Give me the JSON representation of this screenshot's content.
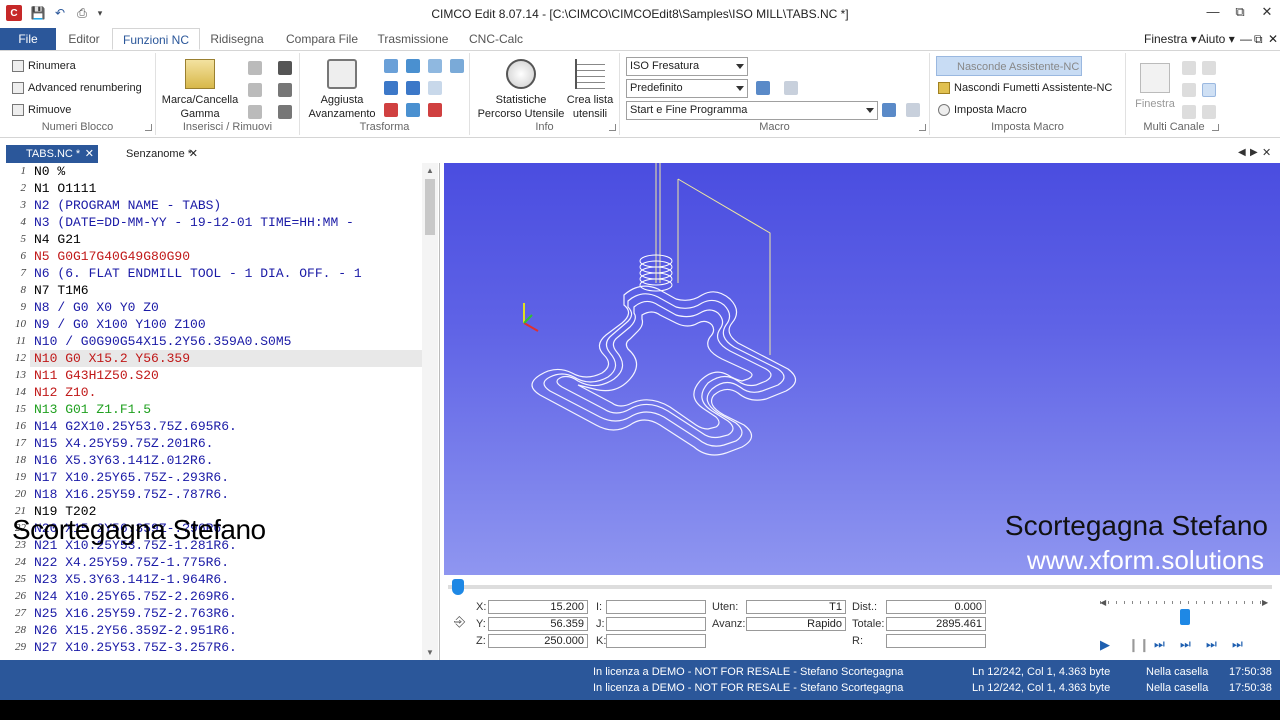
{
  "app": {
    "title": "CIMCO Edit 8.07.14 - [C:\\CIMCO\\CIMCOEdit8\\Samples\\ISO MILL\\TABS.NC *]"
  },
  "tabs": {
    "file": "File",
    "items": [
      "Editor",
      "Funzioni NC",
      "Ridisegna",
      "Compara File",
      "Trasmissione",
      "CNC-Calc"
    ],
    "active": "Funzioni NC",
    "right_menus": [
      "Finestra",
      "Aiuto"
    ]
  },
  "ribbon": {
    "numeri_blocco": {
      "label": "Numeri Blocco",
      "buttons": [
        "Rinumera",
        "Advanced renumbering",
        "Rimuove"
      ]
    },
    "inserisci": {
      "label": "Inserisci / Rimuovi",
      "big_button": "Marca/Cancella Gamma"
    },
    "trasforma": {
      "label": "Trasforma",
      "big_button": "Aggiusta Avanzamento"
    },
    "info": {
      "label": "Info",
      "buttons": [
        "Statistiche Percorso Utensile",
        "Crea lista utensili"
      ]
    },
    "macro": {
      "label": "Macro",
      "combo1": "ISO Fresatura",
      "combo2": "Predefinito",
      "combo3": "Start e Fine Programma"
    },
    "imposta_macro": {
      "label": "Imposta Macro",
      "buttons": [
        "Nasconde Assistente-NC",
        "Nascondi Fumetti Assistente-NC",
        "Imposta Macro"
      ]
    },
    "multi_canale": {
      "label": "Multi Canale",
      "button": "Finestra"
    }
  },
  "doc_tabs": [
    {
      "label": "TABS.NC *",
      "active": true
    },
    {
      "label": "Senzanome *",
      "active": false
    }
  ],
  "editor": {
    "lines": [
      {
        "n": "1",
        "text": "N0 %",
        "color": "#000000"
      },
      {
        "n": "2",
        "text": "N1 O1111",
        "color": "#000000"
      },
      {
        "n": "3",
        "text": "N2 (PROGRAM NAME - TABS)",
        "color": "#1a1aa6"
      },
      {
        "n": "4",
        "text": "N3 (DATE=DD-MM-YY - 19-12-01 TIME=HH:MM - ",
        "color": "#1a1aa6"
      },
      {
        "n": "5",
        "text": "N4 G21",
        "color": "#000000"
      },
      {
        "n": "6",
        "text": "N5 G0G17G40G49G80G90",
        "color": "#c01818"
      },
      {
        "n": "7",
        "text": "N6 (6. FLAT ENDMILL TOOL - 1 DIA. OFF. - 1",
        "color": "#1a1aa6"
      },
      {
        "n": "8",
        "text": "N7 T1M6",
        "color": "#000000"
      },
      {
        "n": "9",
        "text": "N8 / G0 X0 Y0 Z0",
        "color": "#1a1aa6"
      },
      {
        "n": "10",
        "text": "N9 / G0 X100 Y100 Z100",
        "color": "#1a1aa6"
      },
      {
        "n": "11",
        "text": "N10 / G0G90G54X15.2Y56.359A0.S0M5",
        "color": "#1a1aa6"
      },
      {
        "n": "12",
        "text": "N10 G0 X15.2 Y56.359",
        "color": "#c01818"
      },
      {
        "n": "13",
        "text": "N11 G43H1Z50.S20",
        "color": "#c01818"
      },
      {
        "n": "14",
        "text": "N12 Z10.",
        "color": "#c01818"
      },
      {
        "n": "15",
        "text": "N13 G01 Z1.F1.5",
        "color": "#1fa01f"
      },
      {
        "n": "16",
        "text": "N14 G2X10.25Y53.75Z.695R6.",
        "color": "#1a1aa6"
      },
      {
        "n": "17",
        "text": "N15 X4.25Y59.75Z.201R6.",
        "color": "#1a1aa6"
      },
      {
        "n": "18",
        "text": "N16 X5.3Y63.141Z.012R6.",
        "color": "#1a1aa6"
      },
      {
        "n": "19",
        "text": "N17 X10.25Y65.75Z-.293R6.",
        "color": "#1a1aa6"
      },
      {
        "n": "20",
        "text": "N18 X16.25Y59.75Z-.787R6.",
        "color": "#1a1aa6"
      },
      {
        "n": "21",
        "text": "N19 T202",
        "color": "#000000"
      },
      {
        "n": "22",
        "text": "N20 X15.2Y56.359Z-.?96R6.",
        "color": "#1a1aa6"
      },
      {
        "n": "23",
        "text": "N21 X10.25Y53.75Z-1.281R6.",
        "color": "#1a1aa6"
      },
      {
        "n": "24",
        "text": "N22 X4.25Y59.75Z-1.775R6.",
        "color": "#1a1aa6"
      },
      {
        "n": "25",
        "text": "N23 X5.3Y63.141Z-1.964R6.",
        "color": "#1a1aa6"
      },
      {
        "n": "26",
        "text": "N24 X10.25Y65.75Z-2.269R6.",
        "color": "#1a1aa6"
      },
      {
        "n": "27",
        "text": "N25 X16.25Y59.75Z-2.763R6.",
        "color": "#1a1aa6"
      },
      {
        "n": "28",
        "text": "N26 X15.2Y56.359Z-2.951R6.",
        "color": "#1a1aa6"
      },
      {
        "n": "29",
        "text": "N27 X10.25Y53.75Z-3.257R6.",
        "color": "#1a1aa6"
      }
    ],
    "highlight_line": 12
  },
  "watermark": {
    "left": "Scortegagna Stefano",
    "right_name": "Scortegagna Stefano",
    "right_url": "www.xform.solutions"
  },
  "sim": {
    "x_label": "X:",
    "x": "15.200",
    "y_label": "Y:",
    "y": "56.359",
    "z_label": "Z:",
    "z": "250.000",
    "i_label": "I:",
    "j_label": "J:",
    "k_label": "K:",
    "uten_label": "Uten:",
    "uten": "T1",
    "avanz_label": "Avanz:",
    "avanz": "Rapido",
    "dist_label": "Dist.:",
    "dist": "0.000",
    "totale_label": "Totale:",
    "totale": "2895.461",
    "r_label": "R:"
  },
  "status": {
    "license1": "In licenza a DEMO - NOT FOR RESALE - Stefano Scortegagna",
    "license2": "In licenza a DEMO - NOT FOR RESALE - Stefano Scortegagna",
    "pos1": "Ln 12/242, Col 1, 4.363 byte",
    "pos2": "Ln 12/242, Col 1, 4.363 byte",
    "mode1": "Nella casella",
    "mode2": "Nella casella",
    "time1": "17:50:38",
    "time2": "17:50:38"
  },
  "colors": {
    "accent": "#2b579a",
    "viewport_top": "#4a4de0",
    "viewport_bottom": "#8f96f0"
  }
}
